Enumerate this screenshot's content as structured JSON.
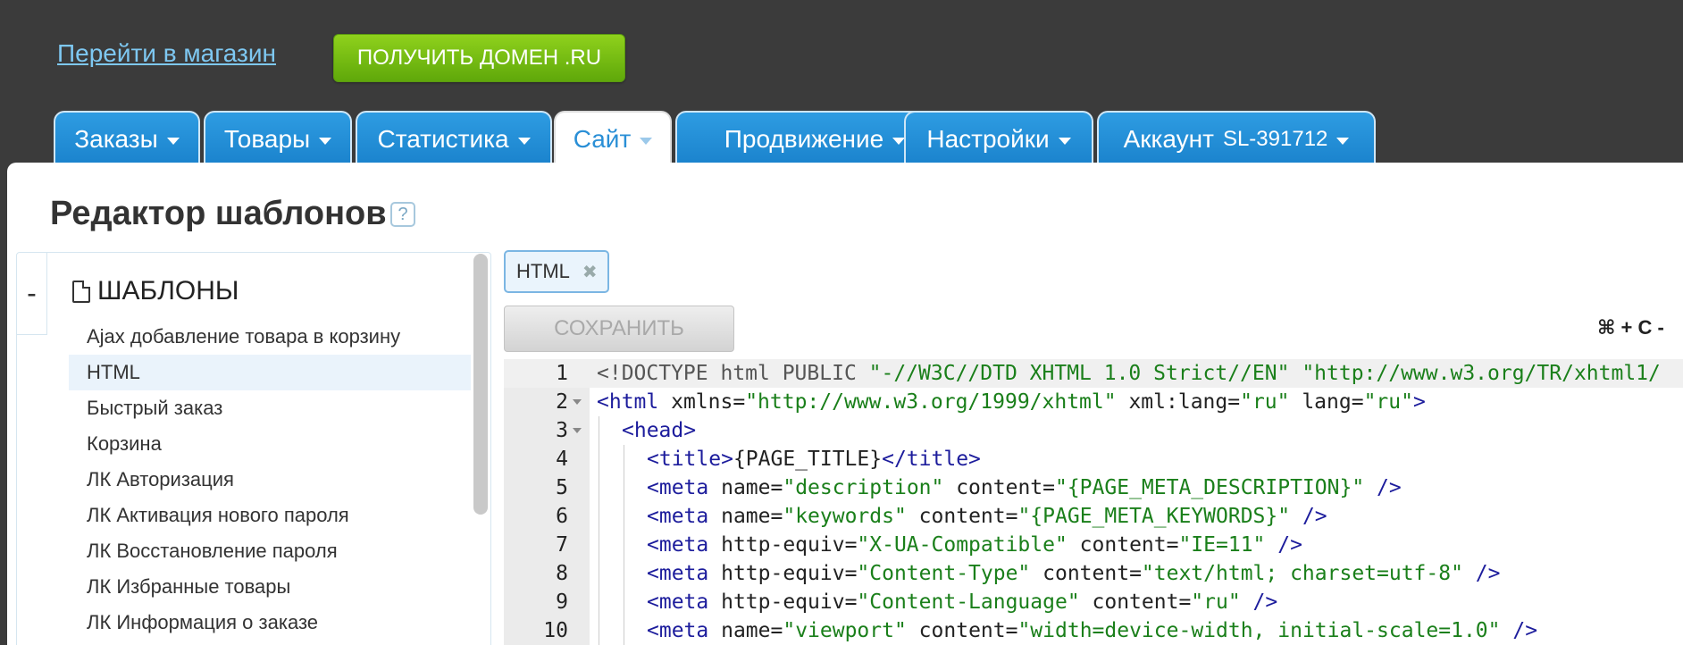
{
  "header": {
    "shop_link": "Перейти в магазин",
    "domain_button": "ПОЛУЧИТЬ ДОМЕН .RU"
  },
  "tabs": [
    {
      "label": "Заказы",
      "active": false
    },
    {
      "label": "Товары",
      "active": false
    },
    {
      "label": "Статистика",
      "active": false
    },
    {
      "label": "Сайт",
      "active": true
    },
    {
      "label": "Продвижение",
      "active": false
    },
    {
      "label": "Настройки",
      "active": false
    },
    {
      "label": "Аккаунт",
      "suffix": "SL-391712",
      "active": false
    }
  ],
  "page": {
    "title": "Редактор шаблонов",
    "help": "?"
  },
  "sidebar": {
    "collapse": "-",
    "heading": "ШАБЛОНЫ",
    "items": [
      "Ajax добавление товара в корзину",
      "HTML",
      "Быстрый заказ",
      "Корзина",
      "ЛК Авторизация",
      "ЛК Активация нового пароля",
      "ЛК Восстановление пароля",
      "ЛК Избранные товары",
      "ЛК Информация о заказе"
    ],
    "selected_index": 1
  },
  "editor": {
    "file_tab": "HTML",
    "save_button": "СОХРАНИТЬ",
    "shortcut": "⌘ + C -",
    "lines": [
      {
        "n": "1",
        "fold": false,
        "indent": 0,
        "parts": [
          [
            "dt",
            "<!DOCTYPE html PUBLIC "
          ],
          [
            "s",
            "\"-//W3C//DTD XHTML 1.0 Strict//EN\""
          ],
          [
            "dt",
            " "
          ],
          [
            "s",
            "\"http://www.w3.org/TR/xhtml1/"
          ]
        ]
      },
      {
        "n": "2",
        "fold": true,
        "indent": 0,
        "parts": [
          [
            "k",
            "<html "
          ],
          [
            "t",
            "xmlns="
          ],
          [
            "s",
            "\"http://www.w3.org/1999/xhtml\""
          ],
          [
            "t",
            " xml:lang="
          ],
          [
            "s",
            "\"ru\""
          ],
          [
            "t",
            " lang="
          ],
          [
            "s",
            "\"ru\""
          ],
          [
            "k",
            ">"
          ]
        ]
      },
      {
        "n": "3",
        "fold": true,
        "indent": 1,
        "parts": [
          [
            "k",
            "<head>"
          ]
        ]
      },
      {
        "n": "4",
        "fold": false,
        "indent": 2,
        "parts": [
          [
            "k",
            "<title>"
          ],
          [
            "t",
            "{PAGE_TITLE}"
          ],
          [
            "k",
            "</title>"
          ]
        ]
      },
      {
        "n": "5",
        "fold": false,
        "indent": 2,
        "parts": [
          [
            "k",
            "<meta "
          ],
          [
            "t",
            "name="
          ],
          [
            "s",
            "\"description\""
          ],
          [
            "t",
            " content="
          ],
          [
            "s",
            "\"{PAGE_META_DESCRIPTION}\""
          ],
          [
            "k",
            " />"
          ]
        ]
      },
      {
        "n": "6",
        "fold": false,
        "indent": 2,
        "parts": [
          [
            "k",
            "<meta "
          ],
          [
            "t",
            "name="
          ],
          [
            "s",
            "\"keywords\""
          ],
          [
            "t",
            " content="
          ],
          [
            "s",
            "\"{PAGE_META_KEYWORDS}\""
          ],
          [
            "k",
            " />"
          ]
        ]
      },
      {
        "n": "7",
        "fold": false,
        "indent": 2,
        "parts": [
          [
            "k",
            "<meta "
          ],
          [
            "t",
            "http-equiv="
          ],
          [
            "s",
            "\"X-UA-Compatible\""
          ],
          [
            "t",
            " content="
          ],
          [
            "s",
            "\"IE=11\""
          ],
          [
            "k",
            " />"
          ]
        ]
      },
      {
        "n": "8",
        "fold": false,
        "indent": 2,
        "parts": [
          [
            "k",
            "<meta "
          ],
          [
            "t",
            "http-equiv="
          ],
          [
            "s",
            "\"Content-Type\""
          ],
          [
            "t",
            " content="
          ],
          [
            "s",
            "\"text/html; charset=utf-8\""
          ],
          [
            "k",
            " />"
          ]
        ]
      },
      {
        "n": "9",
        "fold": false,
        "indent": 2,
        "parts": [
          [
            "k",
            "<meta "
          ],
          [
            "t",
            "http-equiv="
          ],
          [
            "s",
            "\"Content-Language\""
          ],
          [
            "t",
            " content="
          ],
          [
            "s",
            "\"ru\""
          ],
          [
            "k",
            " />"
          ]
        ]
      },
      {
        "n": "10",
        "fold": false,
        "indent": 2,
        "parts": [
          [
            "k",
            "<meta "
          ],
          [
            "t",
            "name="
          ],
          [
            "s",
            "\"viewport\""
          ],
          [
            "t",
            " content="
          ],
          [
            "s",
            "\"width=device-width, initial-scale=1.0\""
          ],
          [
            "k",
            " />"
          ]
        ]
      }
    ]
  }
}
